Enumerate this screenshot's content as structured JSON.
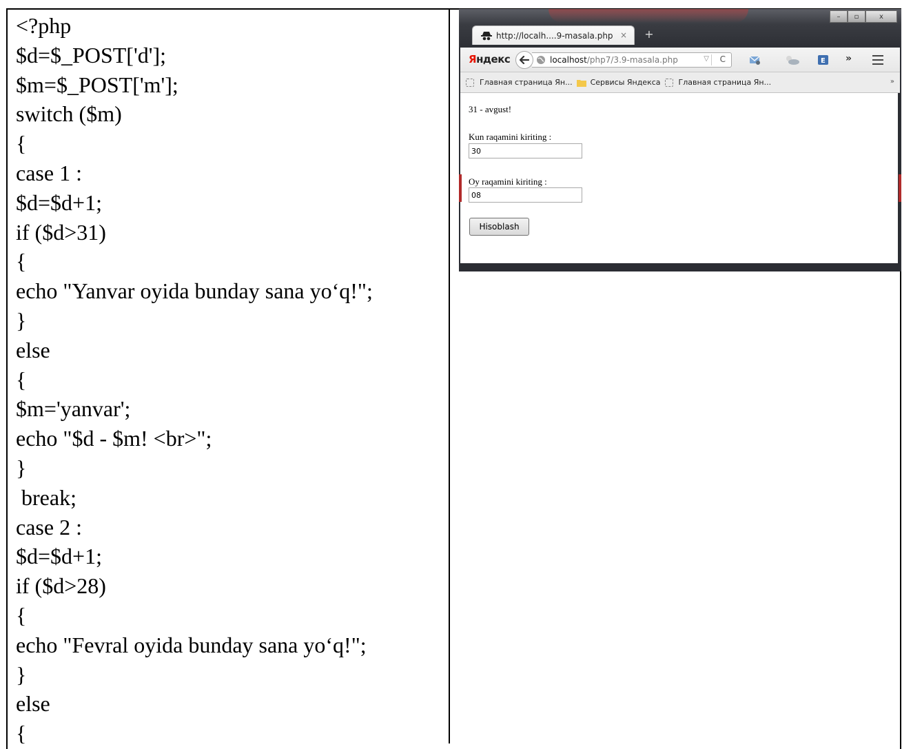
{
  "code_lines": [
    "<?php",
    "$d=$_POST['d'];",
    "$m=$_POST['m'];",
    "switch ($m)",
    "{",
    "case 1 :",
    "$d=$d+1;",
    "if ($d>31)",
    "{",
    "echo \"Yanvar oyida bunday sana yo‘q!\";",
    "}",
    "else",
    "{",
    "$m='yanvar';",
    "echo \"$d - $m! <br>\";",
    "}",
    " break;",
    "case 2 :",
    "$d=$d+1;",
    "if ($d>28)",
    "{",
    "echo \"Fevral oyida bunday sana yo‘q!\";",
    "}",
    "else",
    "{"
  ],
  "browser": {
    "tab_title": "http://localh....9-masala.php",
    "tab_close": "×",
    "new_tab": "+",
    "window_buttons": {
      "minimize": "–",
      "maximize": "▫",
      "close": "x"
    },
    "yandex_first": "Я",
    "yandex_rest": "ндекс",
    "back_glyph": "🡐",
    "url_host": "localhost",
    "url_path": "/php7/3.9-masala.php",
    "url_dropdown": "▽",
    "url_reload": "C",
    "overflow": "»",
    "bookmarks": [
      "Главная страница Ян...",
      "Сервисы Яндекса",
      "Главная страница Ян..."
    ],
    "bookmarks_overflow": "»",
    "icons": [
      "mail-icon",
      "weather-icon",
      "yandex-disk-icon"
    ],
    "page": {
      "result": "31 - avgust!",
      "day_label": "Kun raqamini kiriting :",
      "day_value": "30",
      "month_label": "Oy raqamini kiriting :",
      "month_value": "08",
      "submit_label": "Hisoblash"
    }
  }
}
